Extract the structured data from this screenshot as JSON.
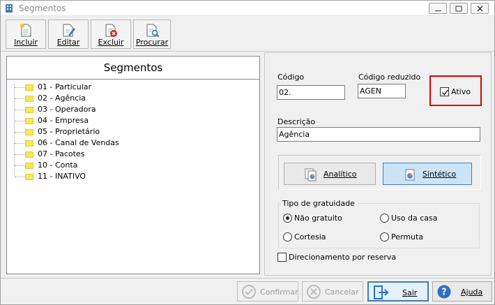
{
  "window": {
    "title": "Segmentos"
  },
  "toolbar": {
    "incluir": "Incluir",
    "editar": "Editar",
    "excluir": "Excluir",
    "procurar": "Procurar"
  },
  "tree": {
    "header": "Segmentos",
    "items": [
      {
        "label": "01 - Particular"
      },
      {
        "label": "02 - Agência"
      },
      {
        "label": "03 - Operadora"
      },
      {
        "label": "04 - Empresa"
      },
      {
        "label": "05 - Proprietário"
      },
      {
        "label": "06 - Canal de Vendas"
      },
      {
        "label": "07 - Pacotes"
      },
      {
        "label": "10 - Conta"
      },
      {
        "label": "11 - INATIVO"
      }
    ]
  },
  "form": {
    "codigo_label": "Código",
    "codigo_value": "02.",
    "codigo_reduzido_label": "Código reduzido",
    "codigo_reduzido_value": "AGEN",
    "ativo_label": "Ativo",
    "ativo_checked": true,
    "descricao_label": "Descrição",
    "descricao_value": "Agência",
    "analitico_label": "Analítico",
    "sintetico_label": "Sintético",
    "selected_mode": "Sintético",
    "tipo_gratuidade_label": "Tipo de gratuidade",
    "radios": {
      "nao_gratuito": "Não gratuito",
      "uso_da_casa": "Uso da casa",
      "cortesia": "Cortesia",
      "permuta": "Permuta"
    },
    "selected_gratuidade": "Não gratuito",
    "direcionamento_label": "Direcionamento por reserva",
    "direcionamento_checked": false
  },
  "buttons": {
    "confirmar": "Confirmar",
    "cancelar": "Cancelar",
    "sair": "Sair",
    "ajuda": "Ajuda"
  },
  "colors": {
    "highlight": "#e00000",
    "selected_button": "#cce4f7",
    "focus_border": "#3c7fb1"
  }
}
